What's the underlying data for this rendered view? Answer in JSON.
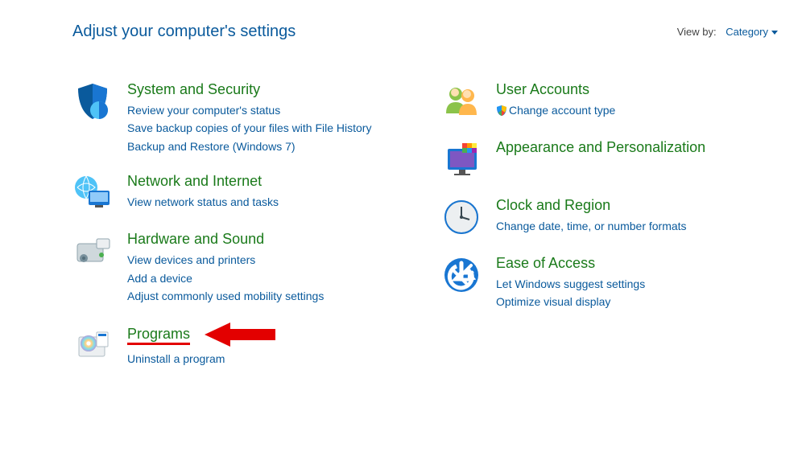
{
  "header": {
    "title": "Adjust your computer's settings",
    "view_by_label": "View by:",
    "view_by_value": "Category"
  },
  "left": [
    {
      "icon": "shield",
      "title": "System and Security",
      "links": [
        "Review your computer's status",
        "Save backup copies of your files with File History",
        "Backup and Restore (Windows 7)"
      ]
    },
    {
      "icon": "network",
      "title": "Network and Internet",
      "links": [
        "View network status and tasks"
      ]
    },
    {
      "icon": "hardware",
      "title": "Hardware and Sound",
      "links": [
        "View devices and printers",
        "Add a device",
        "Adjust commonly used mobility settings"
      ]
    },
    {
      "icon": "programs",
      "title": "Programs",
      "links": [
        "Uninstall a program"
      ],
      "highlight": true
    }
  ],
  "right": [
    {
      "icon": "users",
      "title": "User Accounts",
      "links": [
        "Change account type"
      ],
      "shield_on_first": true
    },
    {
      "icon": "appearance",
      "title": "Appearance and Personalization",
      "links": []
    },
    {
      "icon": "clock",
      "title": "Clock and Region",
      "links": [
        "Change date, time, or number formats"
      ]
    },
    {
      "icon": "ease",
      "title": "Ease of Access",
      "links": [
        "Let Windows suggest settings",
        "Optimize visual display"
      ]
    }
  ]
}
